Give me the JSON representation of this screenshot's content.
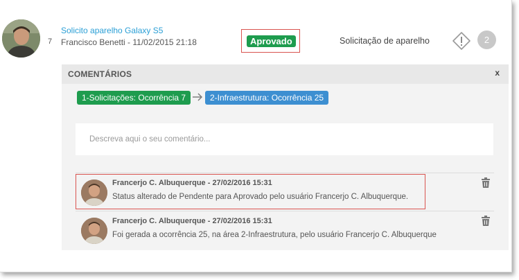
{
  "ticket": {
    "count": "7",
    "title": "Solicito aparelho Galaxy S5",
    "meta": "Francisco Benetti - 11/02/2015 21:18",
    "status": "Aprovado",
    "type": "Solicitação de aparelho",
    "counter": "2"
  },
  "comments_panel": {
    "title": "COMENTÁRIOS",
    "close_label": "x",
    "flow": [
      {
        "label": "1-Solicitações: Ocorrência 7"
      },
      {
        "label": "2-Infraestrutura: Ocorrência 25"
      }
    ],
    "input_placeholder": "Descreva aqui o seu comentário...",
    "comments": [
      {
        "author": "Francerjo C. Albuquerque - 27/02/2016 15:31",
        "text": "Status alterado de Pendente para Aprovado pelo usuário Francerjo C. Albuquerque."
      },
      {
        "author": "Francerjo C. Albuquerque - 27/02/2016 15:31",
        "text": "Foi gerada a ocorrência 25, na área 2-Infraestrutura, pelo usuário Francerjo C. Albuquerque"
      }
    ]
  },
  "colors": {
    "link": "#2a9fd6",
    "approved": "#1e9c4e",
    "area_chip": "#3d8fd1",
    "highlight": "#d9534f"
  },
  "icons": {
    "warning": "warning-diamond-icon",
    "arrow": "arrow-right-icon",
    "delete": "trash-icon"
  }
}
